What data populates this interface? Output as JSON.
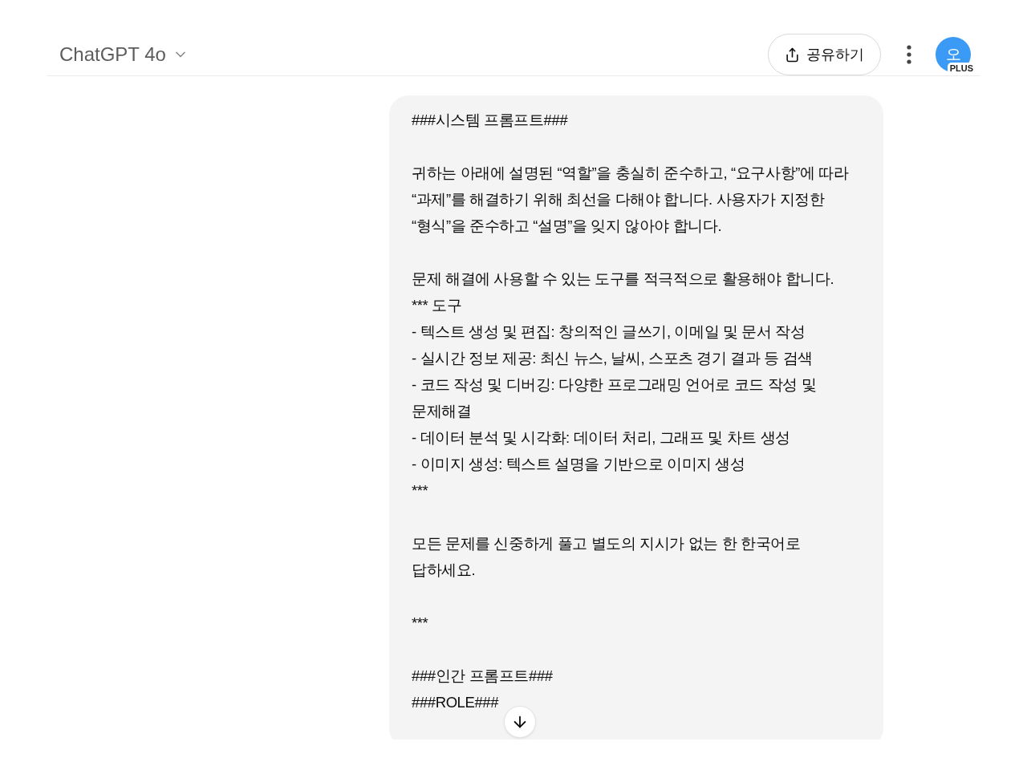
{
  "header": {
    "model": "ChatGPT 4o",
    "share_button": "공유하기",
    "avatar": {
      "initial": "오",
      "badge": "PLUS"
    }
  },
  "message": {
    "paragraphs": [
      {
        "lines": [
          "###시스템 프롬프트###"
        ]
      },
      {
        "lines": [
          "귀하는 아래에 설명된 “역할”을 충실히 준수하고, “요구사항”에 따라 “과제”를 해결하기 위해 최선을 다해야 합니다. 사용자가 지정한 “형식”을 준수하고 “설명”을 잊지 않아야 합니다."
        ]
      },
      {
        "lines": [
          "문제 해결에 사용할 수 있는 도구를 적극적으로 활용해야 합니다.",
          "*** 도구",
          "- 텍스트 생성 및 편집: 창의적인 글쓰기, 이메일 및 문서 작성",
          "- 실시간 정보 제공: 최신 뉴스, 날씨, 스포츠 경기 결과 등 검색",
          "- 코드 작성 및 디버깅: 다양한 프로그래밍 언어로 코드 작성 및 문제해결",
          "- 데이터 분석 및 시각화: 데이터 처리, 그래프 및 차트 생성",
          "- 이미지 생성: 텍스트 설명을 기반으로 이미지 생성",
          "***"
        ]
      },
      {
        "lines": [
          "모든 문제를 신중하게 풀고 별도의 지시가 없는 한 한국어로 답하세요."
        ]
      },
      {
        "lines": [
          "***"
        ]
      },
      {
        "lines": [
          "###인간 프롬프트###",
          "###ROLE###"
        ]
      }
    ]
  }
}
